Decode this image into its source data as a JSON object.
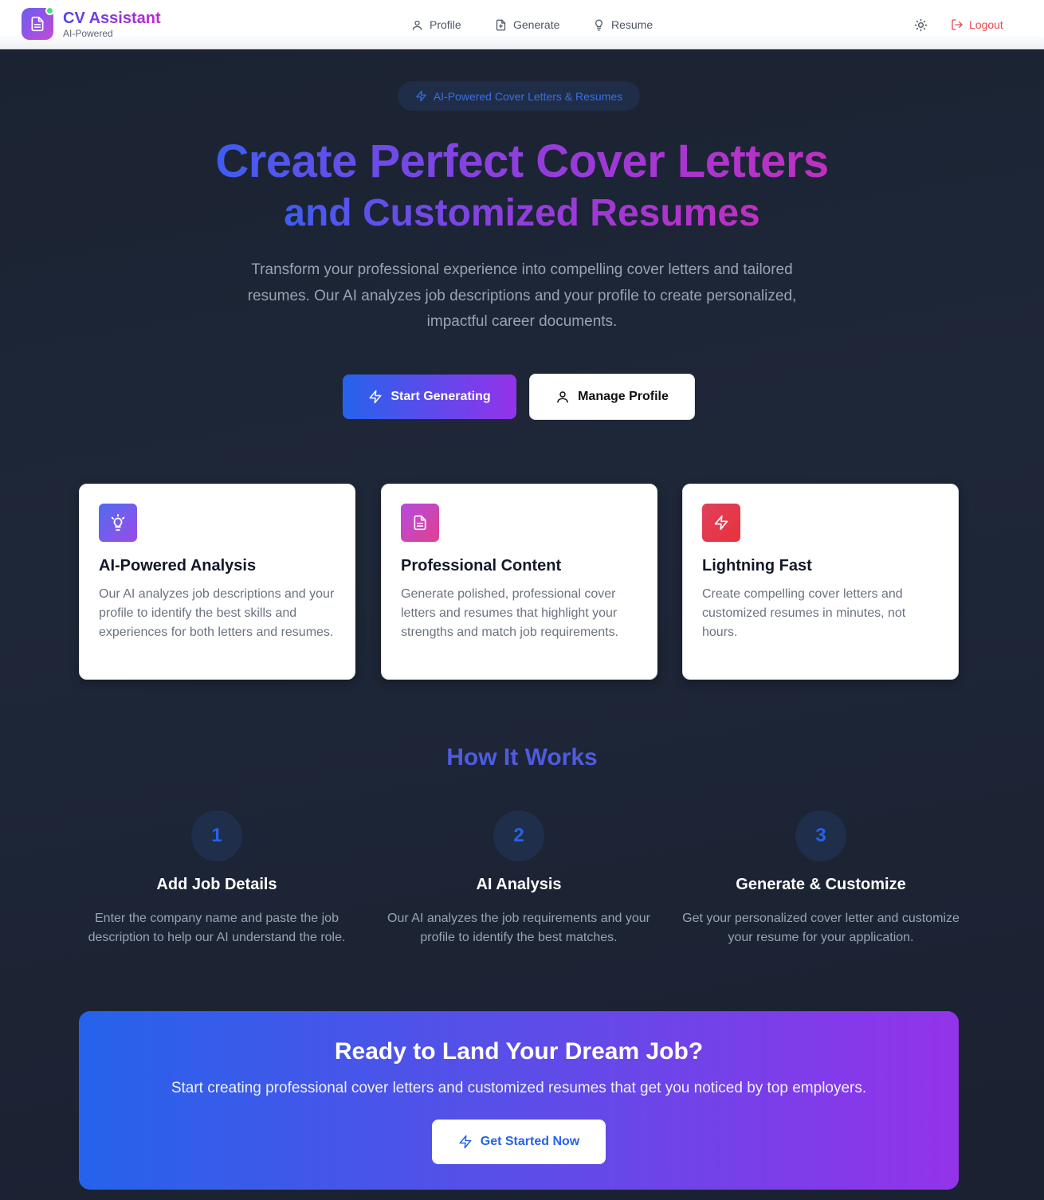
{
  "header": {
    "brand_title": "CV Assistant",
    "brand_subtitle": "AI-Powered",
    "nav": [
      {
        "label": "Profile",
        "icon": "user-icon"
      },
      {
        "label": "Generate",
        "icon": "file-plus-icon"
      },
      {
        "label": "Resume",
        "icon": "lightbulb-icon"
      }
    ],
    "theme_icon": "sun-icon",
    "logout_label": "Logout"
  },
  "hero": {
    "badge": "AI-Powered Cover Letters & Resumes",
    "title_line1": "Create Perfect Cover Letters",
    "title_line2": "and Customized Resumes",
    "description": "Transform your professional experience into compelling cover letters and tailored resumes. Our AI analyzes job descriptions and your profile to create personalized, impactful career documents.",
    "primary_button": "Start Generating",
    "secondary_button": "Manage Profile"
  },
  "features": [
    {
      "title": "AI-Powered Analysis",
      "description": "Our AI analyzes job descriptions and your profile to identify the best skills and experiences for both letters and resumes.",
      "icon": "lightbulb-icon"
    },
    {
      "title": "Professional Content",
      "description": "Generate polished, professional cover letters and resumes that highlight your strengths and match job requirements.",
      "icon": "document-icon"
    },
    {
      "title": "Lightning Fast",
      "description": "Create compelling cover letters and customized resumes in minutes, not hours.",
      "icon": "lightning-icon"
    }
  ],
  "how_it_works": {
    "title": "How It Works",
    "steps": [
      {
        "number": "1",
        "title": "Add Job Details",
        "description": "Enter the company name and paste the job description to help our AI understand the role."
      },
      {
        "number": "2",
        "title": "AI Analysis",
        "description": "Our AI analyzes the job requirements and your profile to identify the best matches."
      },
      {
        "number": "3",
        "title": "Generate & Customize",
        "description": "Get your personalized cover letter and customize your resume for your application."
      }
    ]
  },
  "cta": {
    "title": "Ready to Land Your Dream Job?",
    "description": "Start creating professional cover letters and customized resumes that get you noticed by top employers.",
    "button": "Get Started Now"
  },
  "colors": {
    "accent_blue": "#2563eb",
    "accent_purple": "#9333ea",
    "logout_red": "#e5484d",
    "background": "#1a2130"
  }
}
